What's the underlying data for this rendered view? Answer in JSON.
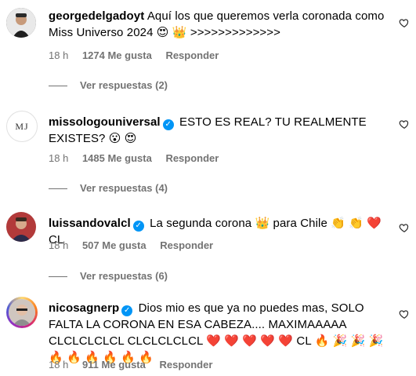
{
  "comments": [
    {
      "username": "georgedelgadoyt",
      "verified": false,
      "text": "Aquí los que queremos verla coronada como Miss Universo 2024 😍 👑 >>>>>>>>>>>>>",
      "time": "18 h",
      "likes": "1274 Me gusta",
      "reply_label": "Responder",
      "view_replies": "Ver respuestas (2)"
    },
    {
      "username": "missologouniversal",
      "verified": true,
      "text": "ESTO ES REAL? TU REALMENTE EXISTES? 😮 😍",
      "time": "18 h",
      "likes": "1485 Me gusta",
      "reply_label": "Responder",
      "view_replies": "Ver respuestas (4)"
    },
    {
      "username": "luissandovalcl",
      "verified": true,
      "text": "La segunda corona 👑  para Chile 👏 👏 ❤️ CL",
      "time": "18 h",
      "likes": "507 Me gusta",
      "reply_label": "Responder",
      "view_replies": "Ver respuestas (6)"
    },
    {
      "username": "nicosagnerp",
      "verified": true,
      "text": "Dios mio es que ya no puedes mas, SOLO FALTA LA CORONA EN ESA CABEZA.... MAXIMAAAAA CLCLCLCLCL CLCLCLCLCL ❤️ ❤️ ❤️ ❤️ ❤️ CL 🔥 🎉 🎉 🎉 🔥 🔥 🔥 🔥 🔥 🔥",
      "time": "18 h",
      "likes": "911 Me gusta",
      "reply_label": "Responder"
    }
  ],
  "avatar_initials": {
    "missologo": "MJ"
  },
  "colors": {
    "verified": "#0095f6",
    "meta": "#737373"
  },
  "icons": {
    "like": "heart-outline-icon",
    "verified": "verified-badge-icon"
  }
}
